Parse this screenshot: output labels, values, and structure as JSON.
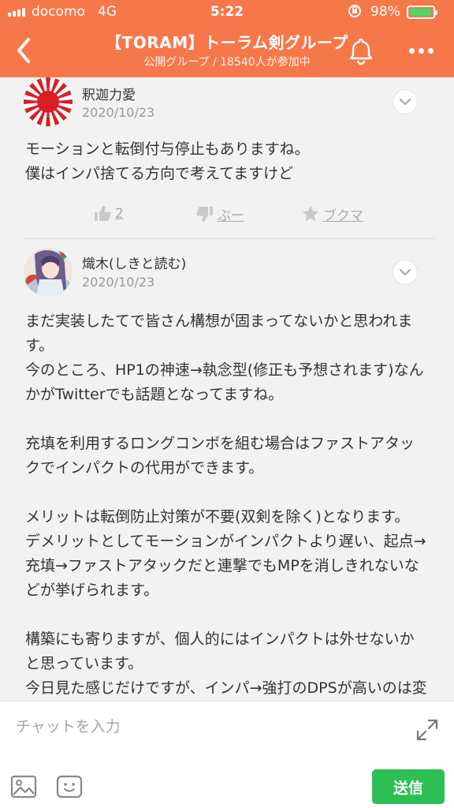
{
  "status_bar": {
    "carrier": "docomo",
    "network": "4G",
    "time": "5:22",
    "battery_percent": "98%",
    "battery_level": 0.98
  },
  "header": {
    "title": "【TORAM】トーラム剣グループ",
    "subtitle": "公開グループ / 18540人が参加中",
    "back_icon": "chevron-left-icon",
    "bell_icon": "bell-icon",
    "more_icon": "more-dots-icon"
  },
  "posts": [
    {
      "author": "釈迦力愛",
      "date": "2020/10/23",
      "avatar": "rising-sun-avatar",
      "body": [
        "モーションと転倒付与停止もありますね。\n僕はインパ捨てる方向で考えてますけど"
      ],
      "actions": {
        "like": "2",
        "boo": "ぶー",
        "bookmark": "ブクマ"
      }
    },
    {
      "author": "熾木(しきと読む)",
      "date": "2020/10/23",
      "avatar": "anime-character-avatar",
      "body": [
        "まだ実装したてで皆さん構想が固まってないかと思われます。\n今のところ、HP1の神速→執念型(修正も予想されます)なんかがTwitterでも話題となってますね。",
        "充填を利用するロングコンボを組む場合はファストアタックでインパクトの代用ができます。",
        "メリットは転倒防止対策が不要(双剣を除く)となります。\nデメリットとしてモーションがインパクトより遅い、起点→充填→ファストアタックだと連撃でもMPを消しきれないなどが挙げられます。",
        "構築にも寄りますが、個人的にはインパクトは外せないかと思っています。\n今日見た感じだけですが、インパ→強打のDPSが高いのは変わらないという印象です。"
      ]
    }
  ],
  "input": {
    "placeholder": "チャットを入力",
    "send_label": "送信"
  },
  "colors": {
    "accent": "#f6784a",
    "send": "#2dbf54",
    "battery": "#4cd964"
  }
}
